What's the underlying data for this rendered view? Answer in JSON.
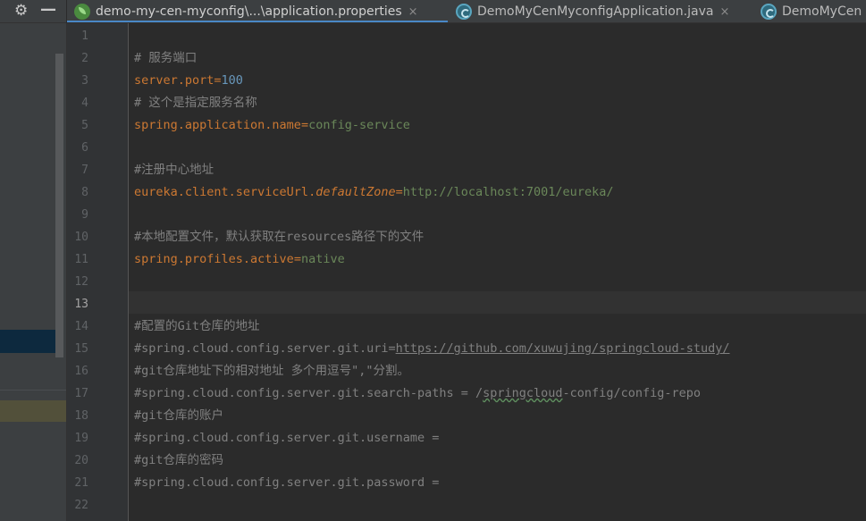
{
  "window": {
    "gear_icon": "gear-icon",
    "minimize_icon": "minimize-icon"
  },
  "tabs": [
    {
      "label": "demo-my-cen-myconfig\\...\\application.properties",
      "icon": "spring-properties-icon",
      "active": true,
      "close": "×"
    },
    {
      "label": "DemoMyCenMyconfigApplication.java",
      "icon": "java-class-icon",
      "active": false,
      "close": "×"
    },
    {
      "label": "DemoMyCen",
      "icon": "java-class-icon",
      "active": false
    }
  ],
  "editor": {
    "current_line": 13,
    "lines": [
      {
        "n": "1"
      },
      {
        "n": "2",
        "comment": "# 服务端口"
      },
      {
        "n": "3",
        "key": "server.port",
        "eq": "=",
        "num": "100"
      },
      {
        "n": "4",
        "comment": "# 这个是指定服务名称"
      },
      {
        "n": "5",
        "key": "spring.application.name",
        "eq": "=",
        "val": "config-service"
      },
      {
        "n": "6"
      },
      {
        "n": "7",
        "comment": "#注册中心地址"
      },
      {
        "n": "8",
        "key": "eureka.client.serviceUrl.",
        "key_italic": "defaultZone",
        "eq": "=",
        "val": "http://localhost:7001/eureka/"
      },
      {
        "n": "9"
      },
      {
        "n": "10",
        "comment": "#本地配置文件，默认获取在resources路径下的文件"
      },
      {
        "n": "11",
        "key": "spring.profiles.active",
        "eq": "=",
        "val": "native"
      },
      {
        "n": "12"
      },
      {
        "n": "13"
      },
      {
        "n": "14",
        "comment": "#配置的Git仓库的地址"
      },
      {
        "n": "15",
        "comment": "#spring.cloud.config.server.git.uri=",
        "link": "https://github.com/xuwujing/springcloud-study/"
      },
      {
        "n": "16",
        "comment": "#git仓库地址下的相对地址 多个用逗号\",\"分割。"
      },
      {
        "n": "17",
        "comment": "#spring.cloud.config.server.git.search-paths = /",
        "typo": "springcloud",
        "tail": "-config/config-repo"
      },
      {
        "n": "18",
        "comment": "#git仓库的账户"
      },
      {
        "n": "19",
        "comment": "#spring.cloud.config.server.git.username ="
      },
      {
        "n": "20",
        "comment": "#git仓库的密码"
      },
      {
        "n": "21",
        "comment": "#spring.cloud.config.server.git.password ="
      },
      {
        "n": "22"
      }
    ]
  },
  "colors": {
    "background": "#2b2b2b",
    "gutter": "#313335",
    "comment": "#808080",
    "key": "#cc7832",
    "value": "#6a8759",
    "number": "#6897bb",
    "tab_underline": "#4a88c7"
  }
}
